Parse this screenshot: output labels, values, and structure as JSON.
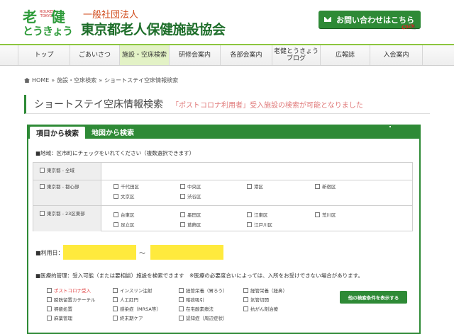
{
  "header": {
    "logo_kanji_1": "老",
    "logo_kanji_2": "健",
    "logo_romaji": "ROUKEN TOKYO",
    "logo_hiragana": "とうきょう",
    "org_type": "一般社団法人",
    "org_name": "東京都老人保健施設協会",
    "contact_label": "お問い合わせはこちら",
    "click_badge": "Click",
    "contact_icon": "mail-icon"
  },
  "nav": {
    "items": [
      {
        "label": "トップ"
      },
      {
        "label": "ごあいさつ"
      },
      {
        "label": "施設・空床検索"
      },
      {
        "label": "研修会案内"
      },
      {
        "label": "各部会案内"
      },
      {
        "label": "老健とうきょうブログ"
      },
      {
        "label": "広報誌"
      },
      {
        "label": "入会案内"
      }
    ]
  },
  "breadcrumb": {
    "home": "HOME",
    "sep": "»",
    "level1": "施設・空床検索",
    "current": "ショートステイ空床情報検索"
  },
  "page": {
    "title": "ショートステイ空床情報検索",
    "note": "「ポストコロナ利用者」受入施設の検索が可能となりました"
  },
  "tabs": {
    "active": "項目から検索",
    "inactive": "地図から検索"
  },
  "area": {
    "label": "■地域：区市町にチェックをいれてください（複数選択できます）",
    "rows": [
      {
        "head": "東京都 - 全域",
        "items": []
      },
      {
        "head": "東京都 - 都心部",
        "items": [
          "千代田区",
          "中央区",
          "港区",
          "新宿区",
          "文京区",
          "渋谷区"
        ]
      },
      {
        "head": "東京都 - 23区東部",
        "items": [
          "台東区",
          "墨田区",
          "江東区",
          "荒川区",
          "足立区",
          "葛飾区",
          "江戸川区"
        ]
      }
    ]
  },
  "date": {
    "label": "■利用日：",
    "tilde": "〜",
    "from_value": "",
    "to_value": ""
  },
  "medical": {
    "label": "■医療的管理：受入可能（または要相談）施設を検索できます　※医療の必要度合いによっては、入所をお受けできない場合があります。",
    "items": [
      "ポストコロナ受入",
      "インスリン注射",
      "経管栄養（胃ろう）",
      "経管栄養（経鼻）",
      "膀胱留置カテーテル",
      "人工肛門",
      "喀痰吸引",
      "気管切開",
      "褥瘡処置",
      "感染症（MRSA等）",
      "在宅酸素療法",
      "抗がん剤治療",
      "麻薬管理",
      "終末期ケア",
      "認知症（周辺症状）"
    ],
    "more_button": "他の検索条件を表示する"
  }
}
